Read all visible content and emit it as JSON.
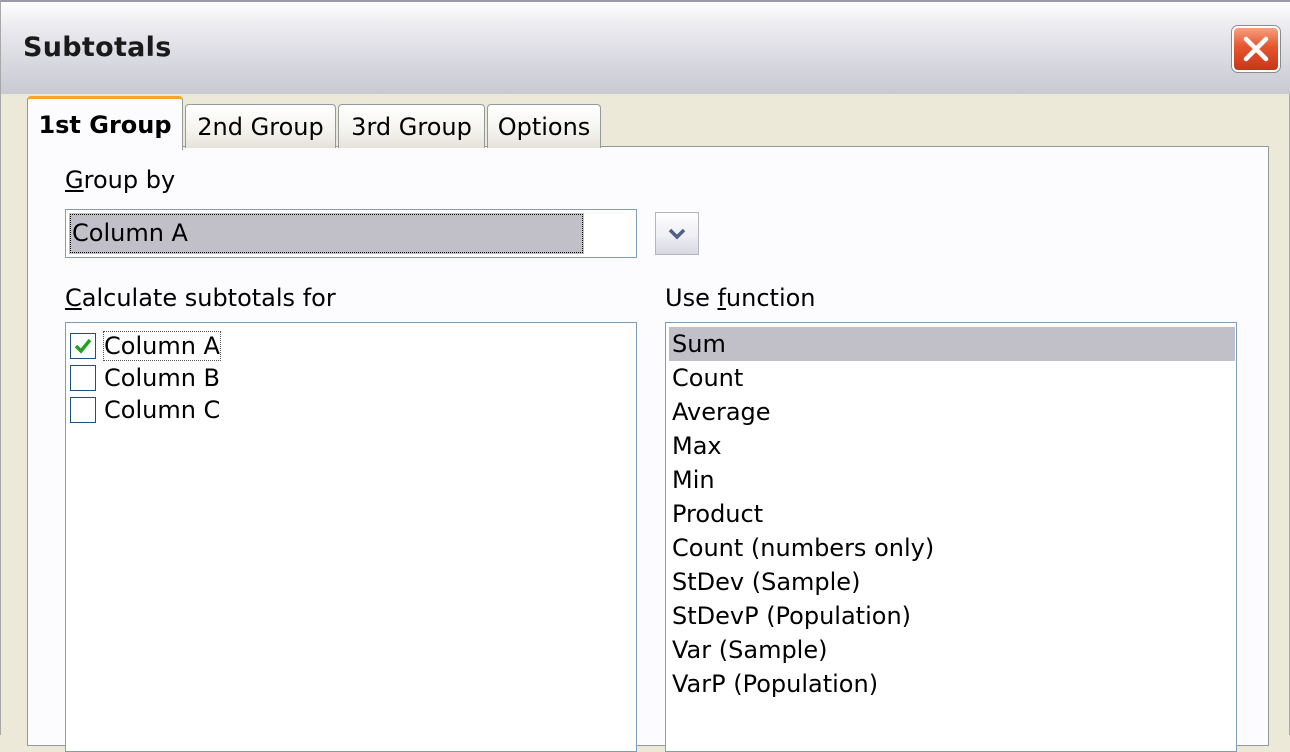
{
  "window": {
    "title": "Subtotals"
  },
  "tabs": [
    {
      "label": "1st Group",
      "active": true
    },
    {
      "label": "2nd Group",
      "active": false
    },
    {
      "label": "3rd Group",
      "active": false
    },
    {
      "label": "Options",
      "active": false
    }
  ],
  "group_by": {
    "label_accel": "G",
    "label_rest": "roup by",
    "selected": "Column A"
  },
  "calculate": {
    "label_accel": "C",
    "label_rest": "alculate subtotals for",
    "columns": [
      {
        "label": "Column A",
        "checked": true
      },
      {
        "label": "Column B",
        "checked": false
      },
      {
        "label": "Column C",
        "checked": false
      }
    ]
  },
  "use_function": {
    "label_pre": "Use ",
    "label_accel": "f",
    "label_rest": "unction",
    "selected": "Sum",
    "items": [
      "Sum",
      "Count",
      "Average",
      "Max",
      "Min",
      "Product",
      "Count (numbers only)",
      "StDev (Sample)",
      "StDevP (Population)",
      "Var (Sample)",
      "VarP (Population)"
    ]
  },
  "colors": {
    "selection": "#c1c0c9",
    "active_tab_accent": "#f5a623",
    "checkmark": "#21a121",
    "close_button": "#e5552e"
  },
  "icons": {
    "close": "close-x-icon",
    "dropdown": "chevron-down-icon",
    "check": "checkmark-icon"
  }
}
